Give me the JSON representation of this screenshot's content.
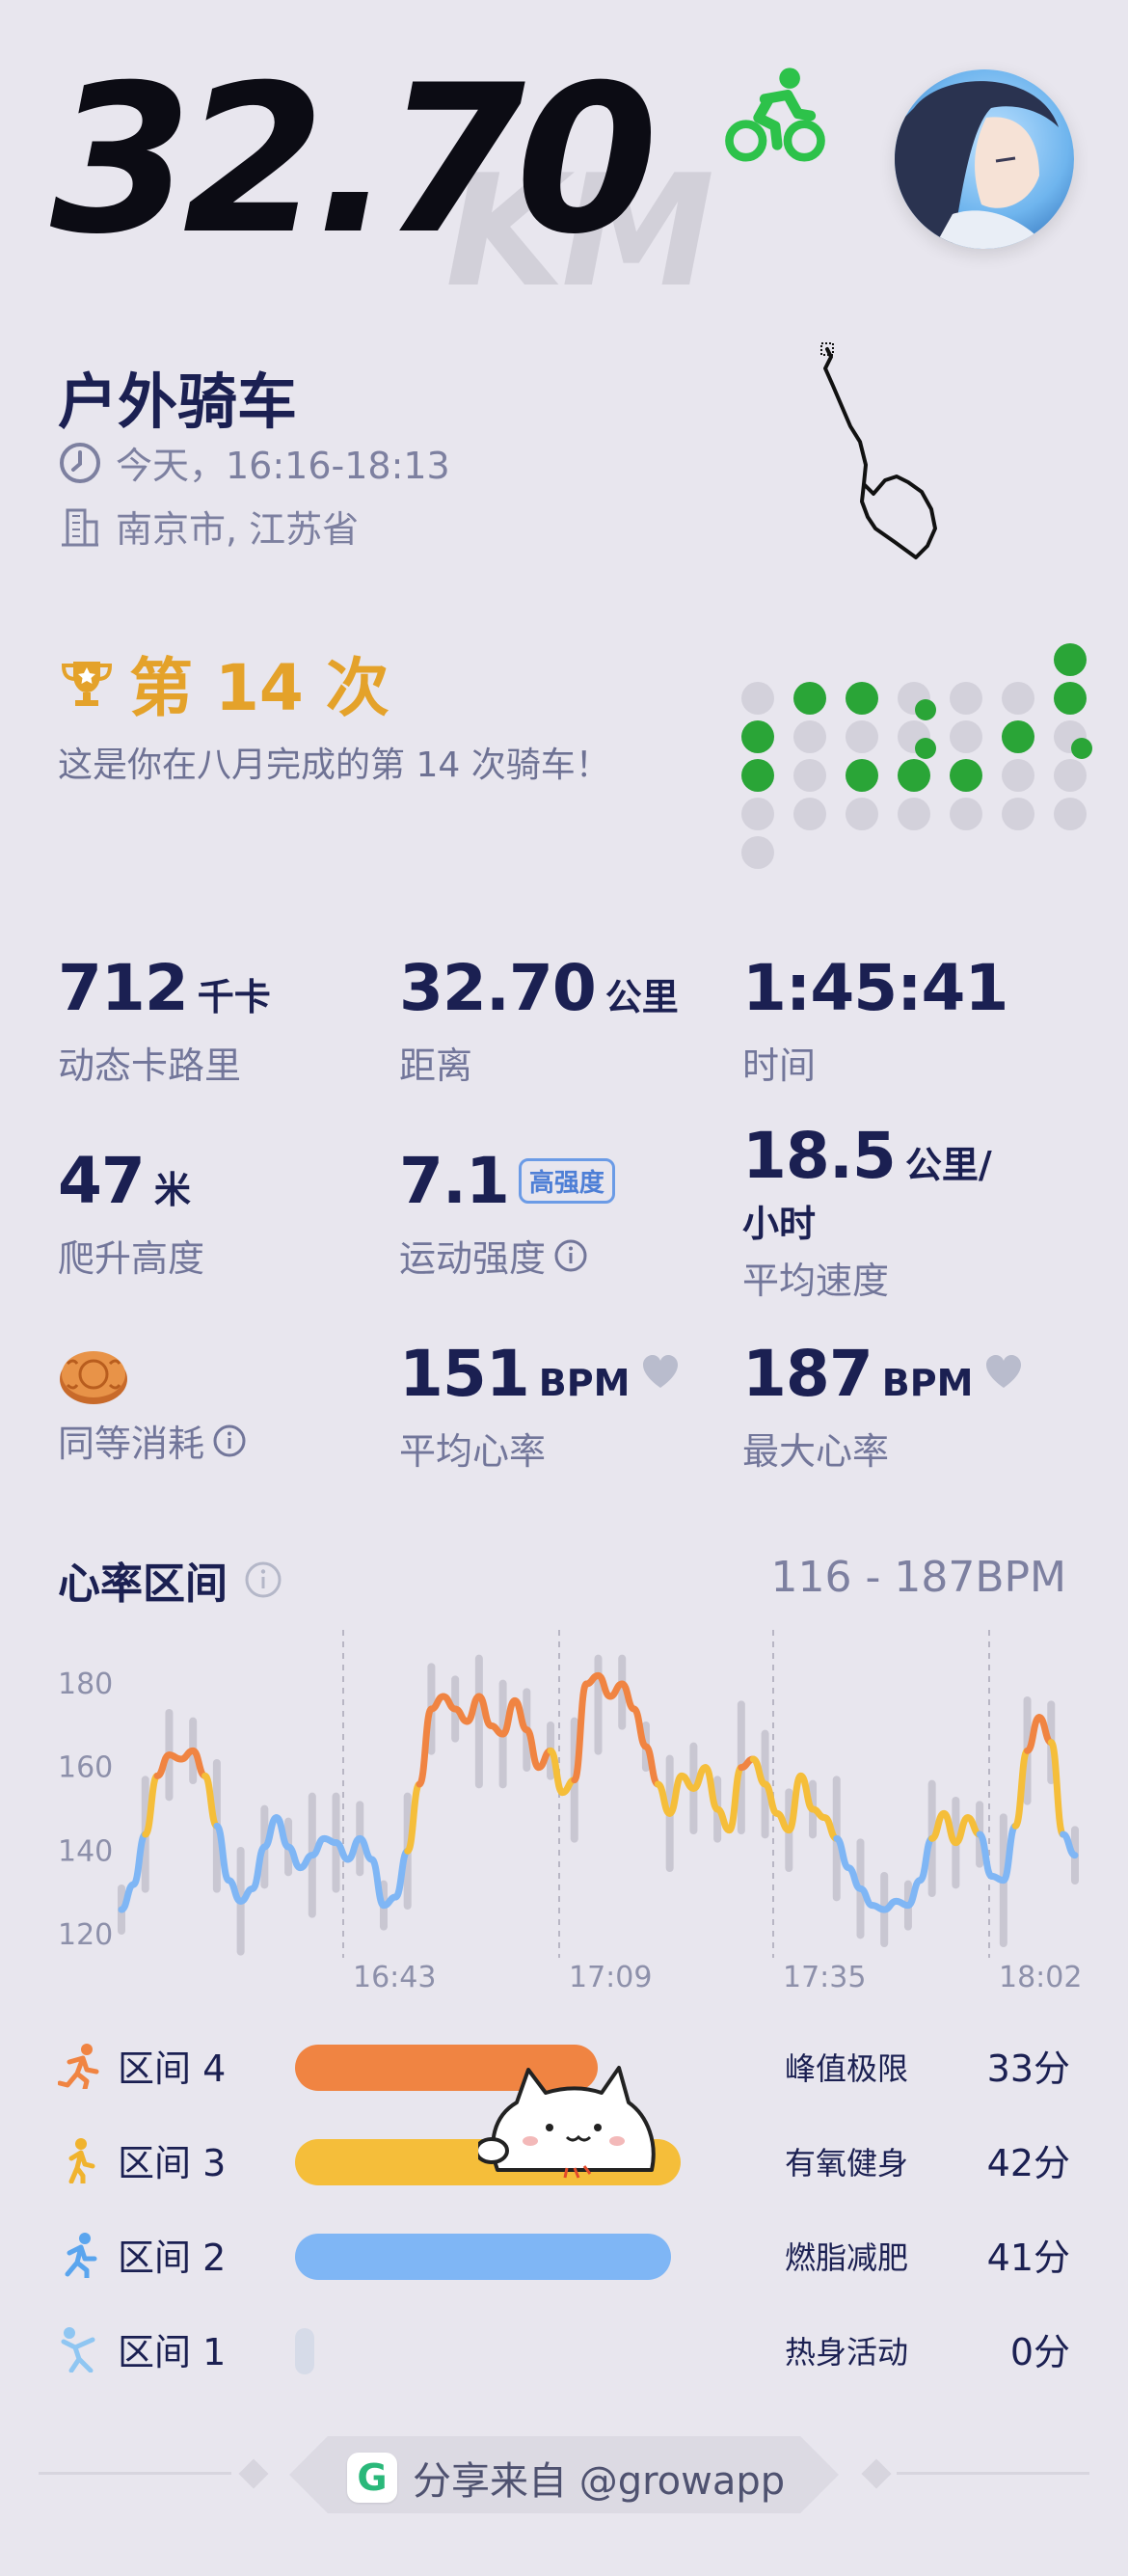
{
  "header": {
    "distance": "32.70",
    "watermark_unit": "KM",
    "activity_icon": "cycling-icon",
    "accent_green": "#2dc24a"
  },
  "activity": {
    "title": "户外骑车",
    "time": "今天，16:16-18:13",
    "location": "南京市, 江苏省"
  },
  "count": {
    "title": "第 14 次",
    "description": "这是你在八月完成的第 14 次骑车！"
  },
  "stats": {
    "calories": {
      "value": "712",
      "unit": "千卡",
      "label": "动态卡路里"
    },
    "distance": {
      "value": "32.70",
      "unit": "公里",
      "label": "距离"
    },
    "duration": {
      "value": "1:45:41",
      "label": "时间"
    },
    "elevation": {
      "value": "47",
      "unit": "米",
      "label": "爬升高度"
    },
    "intensity": {
      "value": "7.1",
      "badge": "高强度",
      "label": "运动强度"
    },
    "speed": {
      "value": "18.5",
      "unit": "公里/",
      "unit2": "小时",
      "label": "平均速度"
    },
    "equivalent": {
      "label": "同等消耗",
      "icon": "mooncake-icon"
    },
    "avg_hr": {
      "value": "151",
      "unit": "BPM",
      "label": "平均心率"
    },
    "max_hr": {
      "value": "187",
      "unit": "BPM",
      "label": "最大心率"
    }
  },
  "heart_rate": {
    "title": "心率区间",
    "range": "116 - 187BPM"
  },
  "chart_data": {
    "type": "line",
    "yticks": [
      "180",
      "160",
      "140",
      "120"
    ],
    "ylim": [
      116,
      187
    ],
    "xticks": [
      "16:43",
      "17:09",
      "17:35",
      "18:02"
    ],
    "series": [
      {
        "values": [
          126,
          132,
          144,
          158,
          163,
          162,
          164,
          158,
          146,
          133,
          128,
          131,
          141,
          148,
          141,
          136,
          139,
          143,
          142,
          138,
          143,
          138,
          127,
          129,
          140,
          156,
          174,
          177,
          174,
          171,
          177,
          170,
          168,
          176,
          169,
          160,
          164,
          154,
          157,
          180,
          182,
          177,
          180,
          174,
          165,
          156,
          149,
          158,
          155,
          160,
          150,
          145,
          160,
          162,
          156,
          149,
          145,
          158,
          150,
          148,
          143,
          136,
          131,
          127,
          126,
          128,
          127,
          133,
          143,
          149,
          142,
          148,
          144,
          134,
          133,
          146,
          164,
          172,
          166,
          144,
          139
        ]
      }
    ],
    "colors": {
      "low": "#7fb6f5",
      "mid": "#f5be3a",
      "high": "#f08442"
    }
  },
  "zones": [
    {
      "name": "区间 4",
      "desc": "峰值极限",
      "minutes": "33分",
      "fraction": 0.785,
      "color": "#f08442",
      "icon": "running-fast-icon",
      "icon_color": "#f08442"
    },
    {
      "name": "区间 3",
      "desc": "有氧健身",
      "minutes": "42分",
      "fraction": 1.0,
      "color": "#f5be3a",
      "icon": "walking-icon",
      "icon_color": "#f0b32e"
    },
    {
      "name": "区间 2",
      "desc": "燃脂减肥",
      "minutes": "41分",
      "fraction": 0.976,
      "color": "#7fb6f5",
      "icon": "jogging-icon",
      "icon_color": "#5aa5ee"
    },
    {
      "name": "区间 1",
      "desc": "热身活动",
      "minutes": "0分",
      "fraction": 0.0,
      "color": "#d6dbe8",
      "icon": "stretching-icon",
      "icon_color": "#8fc6f2"
    }
  ],
  "footer": {
    "text": "分享来自 @growapp",
    "logo_letter": "G"
  }
}
